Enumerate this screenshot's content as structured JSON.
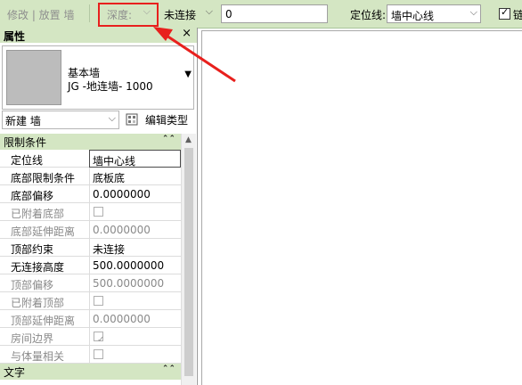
{
  "options_bar": {
    "modify_label": "修改 | 放置 墙",
    "depth_label": "深度:",
    "unconnected_value": "未连接",
    "height_value": "0",
    "location_line_label": "定位线:",
    "location_line_value": "墙中心线",
    "chain_label": "链"
  },
  "properties": {
    "title": "属性",
    "close_glyph": "×",
    "type_family": "基本墙",
    "type_name": "JG -地连墙- 1000",
    "instance_filter": "新建 墙",
    "edit_type_label": "编辑类型",
    "sections": {
      "constraints": "限制条件",
      "text": "文字"
    },
    "rows": [
      {
        "label": "定位线",
        "value": "墙中心线"
      },
      {
        "label": "底部限制条件",
        "value": "底板底"
      },
      {
        "label": "底部偏移",
        "value": "0.0000000"
      },
      {
        "label": "已附着底部",
        "value": ""
      },
      {
        "label": "底部延伸距离",
        "value": "0.0000000"
      },
      {
        "label": "顶部约束",
        "value": "未连接"
      },
      {
        "label": "无连接高度",
        "value": "500.0000000"
      },
      {
        "label": "顶部偏移",
        "value": "500.0000000"
      },
      {
        "label": "已附着顶部",
        "value": ""
      },
      {
        "label": "顶部延伸距离",
        "value": "0.0000000"
      },
      {
        "label": "房间边界",
        "value": "✓"
      },
      {
        "label": "与体量相关",
        "value": ""
      }
    ]
  },
  "colors": {
    "ribbon_green": "#d4e6c3",
    "annotation_red": "#e8201d"
  }
}
